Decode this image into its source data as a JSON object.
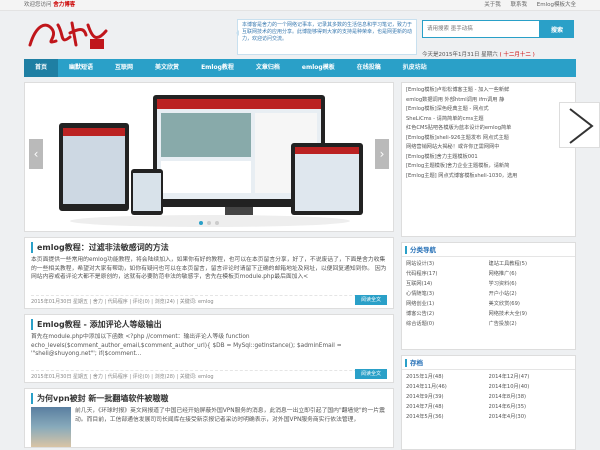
{
  "topbar": {
    "welcome": "欢迎您访问",
    "site_name": "舍力博客",
    "links": [
      "关于我",
      "联系我",
      "Emlog模板大全"
    ]
  },
  "header": {
    "logo_text": "舍力博客",
    "notice": "本博客是舍力的一个网络记事本，记录其多数的生活信息和学习笔记，致力于互联网技术的应用分享。此博能够得到大家的支持是种荣幸，也是网更新的动力，欢迎访问交流。",
    "search_placeholder": "请用搜索 墨手动搞",
    "search_button": "搜索",
    "date_prefix": "今天是2015年1月31日 星期六",
    "date_lunar": "( 十二月十二 )"
  },
  "nav": [
    "首页",
    "幽默短语",
    "互联网",
    "美文欣赏",
    "Emlog教程",
    "文章归档",
    "emlog模板",
    "在线投稿",
    "扒皮坊站"
  ],
  "posts": [
    {
      "title": "emlog教程：过滤非法敏感词的方法",
      "body": "本页面提供一些常用的emlog功能教程，将会陆续加入，如果你有好的教程，也可以在本页留言分享，好了，不说废话了，下面是舍力收集的一些相关教程，希望对大家有帮助，如你有疑问也可以在本页留言，留言评论时请留下正确的邮箱地址及网址，以便回复通知到你。    因为网站内容或者评论大都不是原创的，这就有必要防范非法的敏感字，舍先在模板页module.php最后面加入<",
      "meta": "2015年01月30日 星期五 | 舍力 | 代码程序 | 评论(0) | 浏览(24) | 关键词: emlog",
      "read": "阅读全文"
    },
    {
      "title": "Emlog教程 - 添加评论人等级输出",
      "body": "首先在module.php中添加以下函数 <?php //comment：输出评论人等级 function echo_levels($comment_author_email,$comment_author_url){ $DB = MySql::getInstance(); $adminEmail = '\"sheli@shuyong.net\"'; if($comment...",
      "meta": "2015年01月30日 星期五 | 舍力 | 代码程序 | 评论(0) | 浏览(28) | 关键词: emlog",
      "read": "阅读全文"
    },
    {
      "title": "为何vpn被封 新一批翻墙软件被嗷嗷",
      "body": "前几天，《环球时报》英文网报道了中国已经开始屏蔽外国VPN服务的消息，此消息一出立即引起了国内\"翻墙党\"的一片震动。而目前，工信部通信发展司司长闻库在接受新京报记者采访时明确表示，对外国VPN服务商实行依法管理，"
    }
  ],
  "sidebar": {
    "hot": {
      "items": [
        "[Emlog模板]卢松松博客主题 - 加入一些新鲜",
        "emlog数据调用 外部html调用 ifm调用 静",
        "[Emlog模板]深色经典主题 - 网点式",
        "SheLiCms - 请简简单的cms主题",
        "红色CMS贴吧各模版为蓝本设计的emlog简单",
        "[Emlog模板]sheli-926主题发布 网点式主题",
        "网络营销网站大揭秘！或许你正需网网中",
        "[Emlog模板]舍力主题模板001",
        "[Emlog主题模板]舍力企业主题模板，请新简",
        "[Emlog主题] 网点式博客模板sheli-1030，选用"
      ]
    },
    "categories": {
      "title": "分类导航",
      "items": [
        "网站设计(3)",
        "建站工具教程(5)",
        "代码程序(17)",
        "网络推广(6)",
        "互联网(14)",
        "学习资料(6)",
        "心情随笔(3)",
        "开户小站(2)",
        "网络创业(1)",
        "美文欣赏(69)",
        "博客公告(2)",
        "网络技术大全(9)",
        "综合话题(0)",
        "广告投放(2)"
      ]
    },
    "archive": {
      "title": "存档",
      "items": [
        "2015年1月(48)",
        "2014年12月(47)",
        "2014年11月(46)",
        "2014年10月(40)",
        "2014年9月(39)",
        "2014年8月(38)",
        "2014年7月(48)",
        "2014年6月(35)",
        "2014年5月(36)",
        "2014年4月(30)"
      ]
    }
  }
}
